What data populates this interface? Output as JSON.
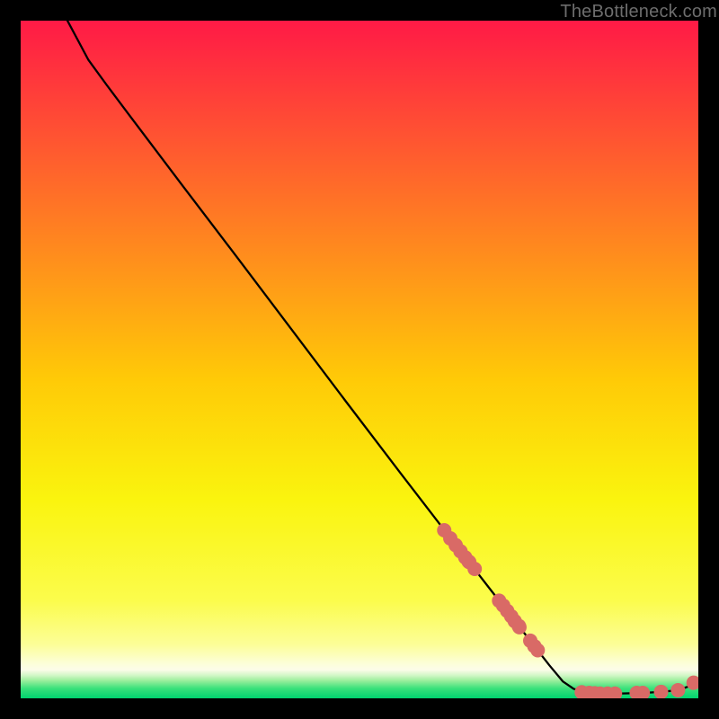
{
  "attribution": "TheBottleneck.com",
  "chart_data": {
    "type": "line",
    "title": "",
    "xlabel": "",
    "ylabel": "",
    "xlim": [
      0,
      100
    ],
    "ylim": [
      0,
      100
    ],
    "background_gradient_stops": [
      {
        "pct": 0.0,
        "color": "#ff1a46"
      },
      {
        "pct": 0.1765,
        "color": "#ff5531"
      },
      {
        "pct": 0.3529,
        "color": "#ff8f1c"
      },
      {
        "pct": 0.5294,
        "color": "#ffca07"
      },
      {
        "pct": 0.7059,
        "color": "#faf40e"
      },
      {
        "pct": 0.8557,
        "color": "#fbfc4c"
      },
      {
        "pct": 0.9202,
        "color": "#fcfe97"
      },
      {
        "pct": 0.9485,
        "color": "#fcfed8"
      },
      {
        "pct": 0.9578,
        "color": "#fcfce9"
      },
      {
        "pct": 0.9661,
        "color": "#d2f7c7"
      },
      {
        "pct": 0.9734,
        "color": "#9eef9e"
      },
      {
        "pct": 0.9853,
        "color": "#3ae17b"
      },
      {
        "pct": 1.0,
        "color": "#00d36f"
      }
    ],
    "series": [
      {
        "name": "bottleneck-curve",
        "stroke": "#000000",
        "data": [
          {
            "x": 6.9,
            "y": 100.0
          },
          {
            "x": 8.4,
            "y": 97.2
          },
          {
            "x": 10.0,
            "y": 94.2
          },
          {
            "x": 12.7,
            "y": 90.5
          },
          {
            "x": 16.0,
            "y": 86.1
          },
          {
            "x": 24.0,
            "y": 75.5
          },
          {
            "x": 32.0,
            "y": 65.0
          },
          {
            "x": 40.0,
            "y": 54.4
          },
          {
            "x": 48.0,
            "y": 43.8
          },
          {
            "x": 56.0,
            "y": 33.3
          },
          {
            "x": 64.0,
            "y": 22.9
          },
          {
            "x": 72.0,
            "y": 12.6
          },
          {
            "x": 78.0,
            "y": 4.9
          },
          {
            "x": 80.0,
            "y": 2.5
          },
          {
            "x": 81.6,
            "y": 1.4
          },
          {
            "x": 83.2,
            "y": 0.9
          },
          {
            "x": 85.0,
            "y": 0.7
          },
          {
            "x": 88.0,
            "y": 0.7
          },
          {
            "x": 92.0,
            "y": 0.8
          },
          {
            "x": 95.0,
            "y": 1.0
          },
          {
            "x": 97.0,
            "y": 1.2
          },
          {
            "x": 98.4,
            "y": 1.7
          },
          {
            "x": 99.3,
            "y": 2.3
          }
        ]
      },
      {
        "name": "points",
        "marker_color": "#d96a66",
        "marker_radius": 8,
        "data": [
          {
            "x": 62.5,
            "y": 24.8
          },
          {
            "x": 63.4,
            "y": 23.6
          },
          {
            "x": 64.2,
            "y": 22.6
          },
          {
            "x": 64.9,
            "y": 21.7
          },
          {
            "x": 65.6,
            "y": 20.8
          },
          {
            "x": 66.2,
            "y": 20.1
          },
          {
            "x": 66.1,
            "y": 20.2
          },
          {
            "x": 67.0,
            "y": 19.1
          },
          {
            "x": 70.6,
            "y": 14.4
          },
          {
            "x": 71.2,
            "y": 13.7
          },
          {
            "x": 71.8,
            "y": 12.9
          },
          {
            "x": 72.4,
            "y": 12.1
          },
          {
            "x": 72.9,
            "y": 11.4
          },
          {
            "x": 73.5,
            "y": 10.7
          },
          {
            "x": 73.6,
            "y": 10.5
          },
          {
            "x": 75.2,
            "y": 8.5
          },
          {
            "x": 75.8,
            "y": 7.7
          },
          {
            "x": 76.3,
            "y": 7.1
          },
          {
            "x": 82.8,
            "y": 0.9
          },
          {
            "x": 83.9,
            "y": 0.8
          },
          {
            "x": 84.7,
            "y": 0.75
          },
          {
            "x": 85.5,
            "y": 0.7
          },
          {
            "x": 86.6,
            "y": 0.7
          },
          {
            "x": 87.7,
            "y": 0.7
          },
          {
            "x": 90.9,
            "y": 0.8
          },
          {
            "x": 91.8,
            "y": 0.8
          },
          {
            "x": 94.5,
            "y": 0.95
          },
          {
            "x": 97.0,
            "y": 1.2
          },
          {
            "x": 99.3,
            "y": 2.3
          }
        ]
      }
    ]
  }
}
